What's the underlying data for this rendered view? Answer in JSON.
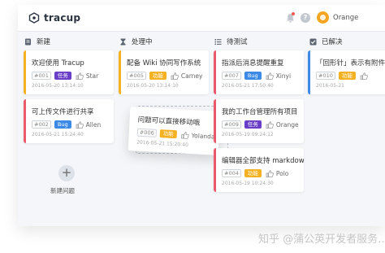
{
  "app": {
    "name": "tracup",
    "user": "Orange",
    "help": "?"
  },
  "columns": [
    {
      "title": "新建"
    },
    {
      "title": "处理中"
    },
    {
      "title": "待测试"
    },
    {
      "title": "已解决"
    }
  ],
  "cards": [
    {
      "title": "欢迎使用 Tracup",
      "id": "#001",
      "tag": "任务",
      "tag_color": "#6a3fc8",
      "assignee": "Star",
      "date": "2016-05-20 13:14:10",
      "bar_color": "#f4b223"
    },
    {
      "title": "可上传文件进行共享",
      "id": "#002",
      "tag": "Bug",
      "tag_color": "#3c8ae6",
      "assignee": "Allen",
      "date": "2016-05-21 15:24:40",
      "bar_color": "#ea5a6b"
    },
    {
      "title": "配备 Wiki 协同写作系统",
      "id": "#005",
      "tag": "功能",
      "tag_color": "#f4b223",
      "assignee": "Carney",
      "date": "2016-05-20 13:14:10",
      "bar_color": "#f4b223"
    },
    {
      "title": "问题可以直接移动哦",
      "id": "#006",
      "tag": "功能",
      "tag_color": "#f4b223",
      "assignee": "Yolanda",
      "date": "2016-05-21 15:20:40",
      "bar_color": "#ffffff"
    },
    {
      "title": "指派后消息提醒重复",
      "id": "#007",
      "tag": "Bug",
      "tag_color": "#3c8ae6",
      "assignee": "Xinyi",
      "date": "2016-05-21 17:50:40",
      "bar_color": "#ea5a6b"
    },
    {
      "title": "我的工作台管理所有项目",
      "id": "#009",
      "tag": "任务",
      "tag_color": "#6a3fc8",
      "assignee": "Orange",
      "date": "2016-05-19 09:24:12",
      "bar_color": "#ea5a6b"
    },
    {
      "title": "编辑器全部支持 markdown",
      "id": "#004",
      "tag": "功能",
      "tag_color": "#f4b223",
      "assignee": "Polo",
      "date": "2016-05-19 10:24:30",
      "bar_color": "#ea5a6b"
    },
    {
      "title": "「回形针」表示有附件",
      "id": "#010",
      "tag": "功能",
      "tag_color": "#f4b223",
      "assignee": "",
      "date": "2016-05-21",
      "bar_color": "#3c8ae6"
    }
  ],
  "add": {
    "symbol": "+",
    "label": "新建问题"
  },
  "watermark": "知乎 @蒲公英开发者服务…"
}
